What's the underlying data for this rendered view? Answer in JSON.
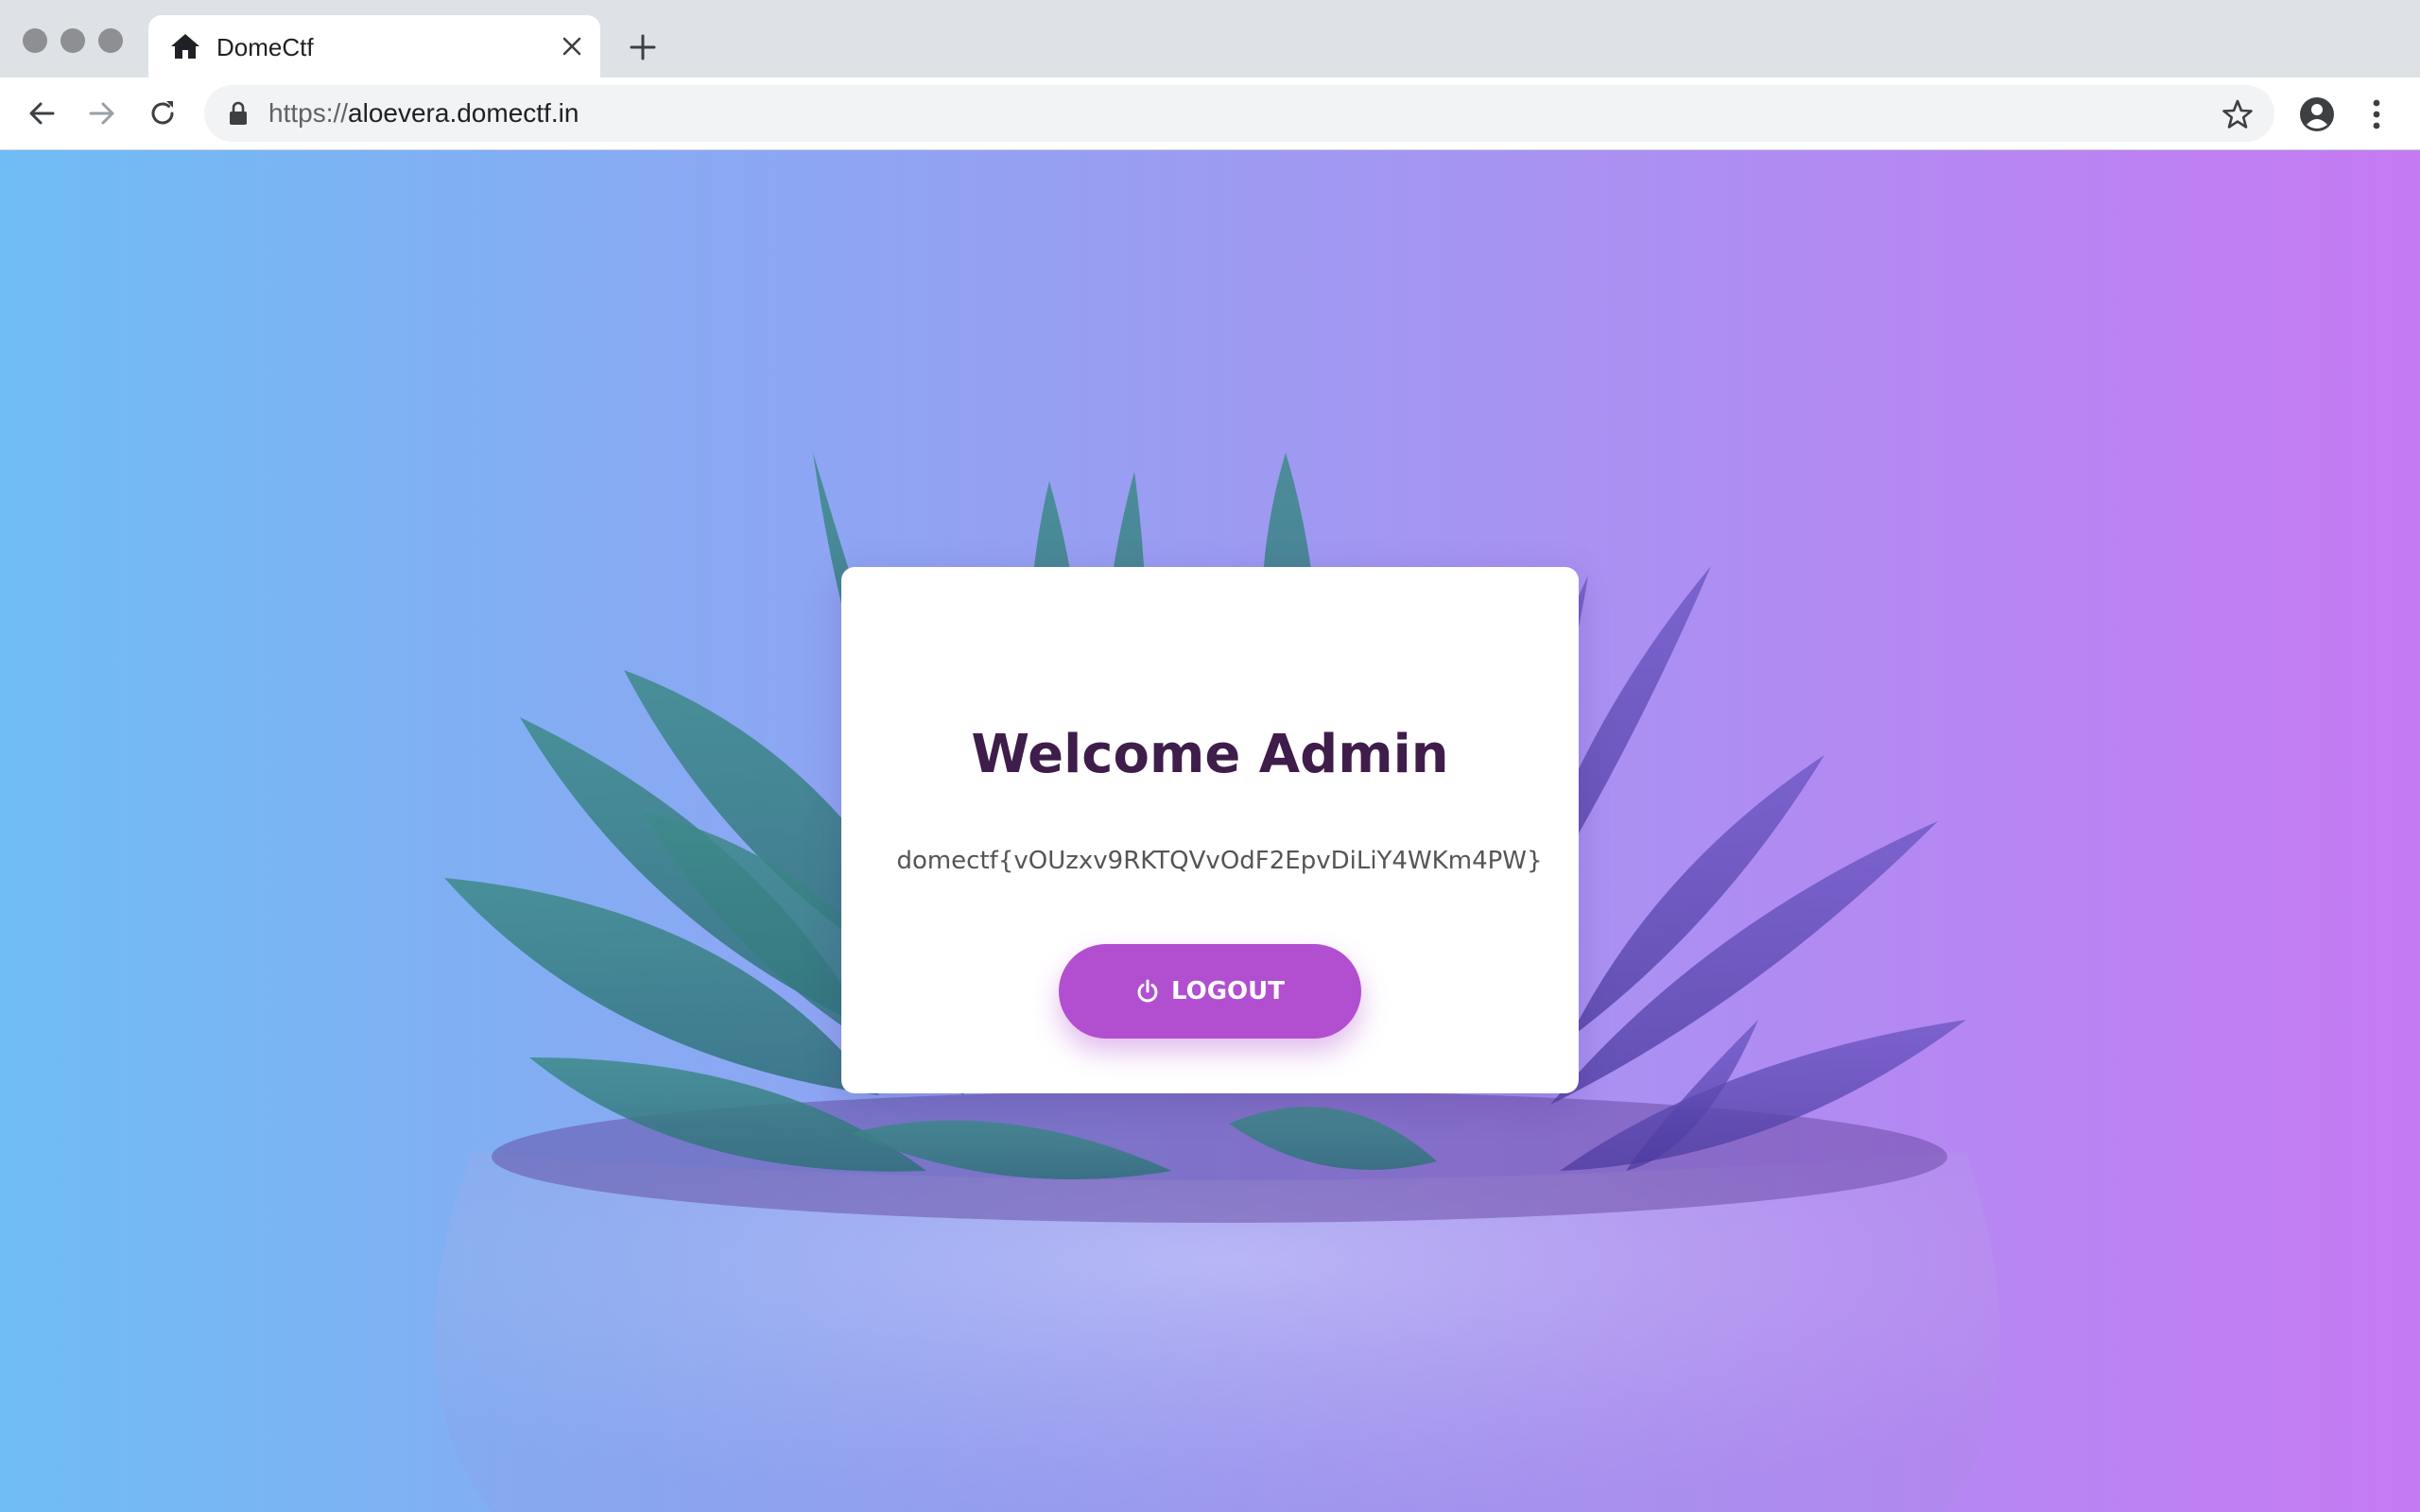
{
  "browser": {
    "tab_title": "DomeCtf",
    "url_scheme": "https://",
    "url_host": "aloevera.domectf.in"
  },
  "page": {
    "title": "Welcome Admin",
    "flag": "domectf{vOUzxv9RKTQVvOdF2EpvDiLiY4WKm4PW}",
    "logout_label": "LOGOUT"
  },
  "icons": {
    "tab": "home-icon",
    "power": "power-icon"
  },
  "colors": {
    "accent": "#b24fd0",
    "title": "#3f1d4a",
    "gradient_start": "#6fbdf3",
    "gradient_end": "#c57af3"
  }
}
